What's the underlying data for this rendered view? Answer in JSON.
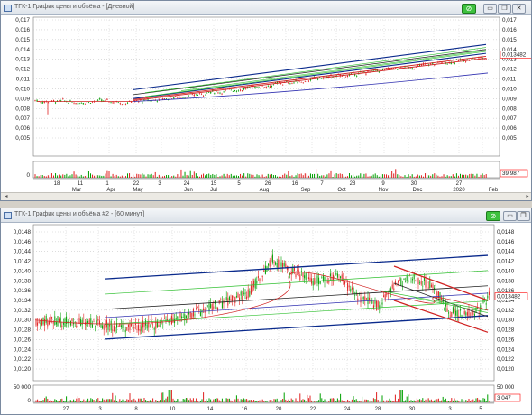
{
  "colors": {
    "candle_up": "#00a000",
    "candle_down": "#e02020",
    "channel": "#0a2a8c",
    "reg": "#202020",
    "envelope": "#30c030",
    "ma_long": "#3030b0",
    "ma_short": "#d02020",
    "price_label": "#ff0000"
  },
  "window1": {
    "title": "ТГК-1 График цены и объёма - [Дневной]",
    "price_axis": [
      "0,017",
      "0,016",
      "0,015",
      "0,014",
      "0,013",
      "0,012",
      "0,011",
      "0,010",
      "0,009",
      "0,008",
      "0,007",
      "0,006",
      "0,005"
    ],
    "price_axis_right": [
      "0,017",
      "0,016",
      "0,015",
      "0,014",
      "0,01348",
      "0,013",
      "0,012",
      "0,011",
      "0,010",
      "0,009",
      "0,008",
      "0,007",
      "0,006",
      "0,005"
    ],
    "current_price": "0,013482",
    "volume_axis_left": "0",
    "volume_right": "39 987",
    "day_labels": [
      "18",
      "11",
      "1",
      "22",
      "3",
      "24",
      "15",
      "5",
      "26",
      "16",
      "7",
      "28",
      "9",
      "30",
      "27"
    ],
    "month_labels": [
      "Mar",
      "Apr",
      "May",
      "Jun",
      "Jul",
      "Aug",
      "Sep",
      "Oct",
      "Nov",
      "Dec",
      "2020",
      "Feb"
    ]
  },
  "window2": {
    "title": "ТГК-1 График цены и объёма #2 - [60 минут]",
    "price_axis": [
      "0,0148",
      "0,0146",
      "0,0144",
      "0,0142",
      "0,0140",
      "0,0138",
      "0,0136",
      "0,0134",
      "0,0132",
      "0,0130",
      "0,0128",
      "0,0126",
      "0,0124",
      "0,0122",
      "0,0120"
    ],
    "price_axis_right": [
      "0,0148",
      "0,0146",
      "0,0144",
      "0,0142",
      "0,0140",
      "0,0138",
      "0,0136",
      "0,0134",
      "0,0132",
      "0,0130",
      "0,0128",
      "0,0126",
      "0,0124",
      "0,0122",
      "0,0120"
    ],
    "current_price": "0,013482",
    "volume_axis_left": [
      "50 000",
      "0"
    ],
    "volume_axis_right": "50 000",
    "volume_right": "3 047",
    "day_labels": [
      "27",
      "3",
      "8",
      "10",
      "14",
      "16",
      "20",
      "22",
      "24",
      "28",
      "30",
      "3",
      "5"
    ]
  },
  "buttons": {
    "link": "⊘",
    "min": "▭",
    "restore": "❐",
    "close": "✕"
  }
}
